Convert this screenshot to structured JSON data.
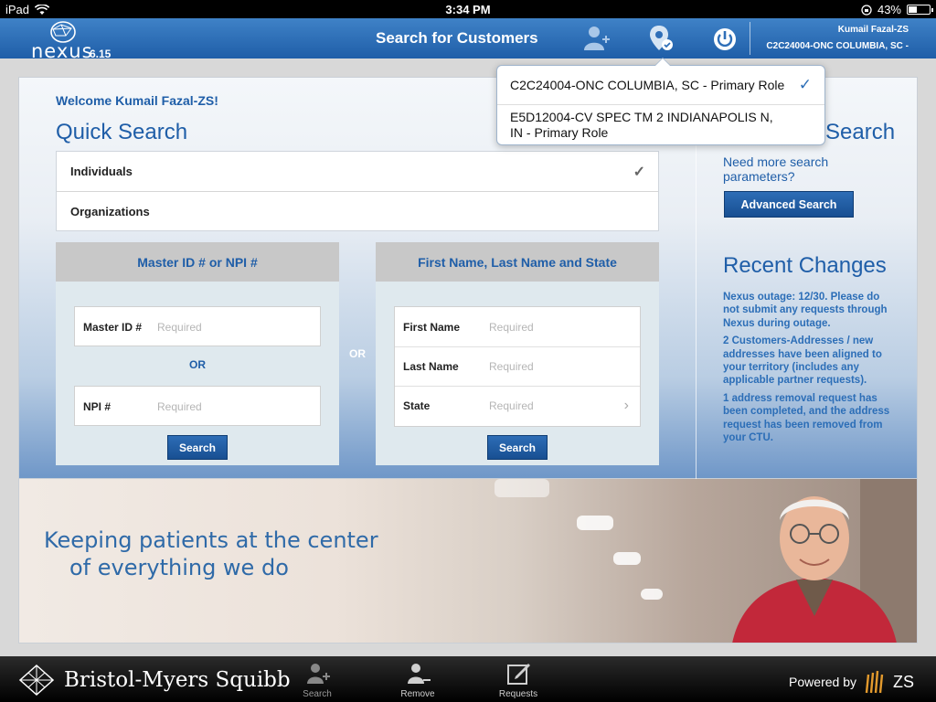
{
  "status_bar": {
    "device": "iPad",
    "time": "3:34 PM",
    "battery": "43%",
    "battery_level": 0.43
  },
  "header": {
    "app_name": "nexus",
    "version": "6.15",
    "title": "Search for Customers",
    "user_name": "Kumail Fazal-ZS",
    "territory": "C2C24004-ONC COLUMBIA, SC -"
  },
  "main": {
    "welcome": "Welcome Kumail Fazal-ZS!",
    "quick_search_title": "Quick Search",
    "segments": [
      {
        "label": "Individuals",
        "selected": true
      },
      {
        "label": "Organizations",
        "selected": false
      }
    ],
    "id_card": {
      "title": "Master ID # or NPI #",
      "master_id_label": "Master ID #",
      "master_id_placeholder": "Required",
      "or_label": "OR",
      "npi_label": "NPI #",
      "npi_placeholder": "Required",
      "search_label": "Search"
    },
    "between_or": "OR",
    "name_card": {
      "title": "First Name, Last Name and State",
      "first_name_label": "First Name",
      "first_name_placeholder": "Required",
      "last_name_label": "Last Name",
      "last_name_placeholder": "Required",
      "state_label": "State",
      "state_placeholder": "Required",
      "search_label": "Search"
    },
    "advanced_title": "Search",
    "need_more": "Need more search parameters?",
    "advanced_button": "Advanced Search",
    "recent_changes_title": "Recent Changes",
    "recent_changes": [
      "Nexus outage: 12/30. Please do not submit any requests through Nexus during outage.",
      "2 Customers-Addresses / new addresses have been aligned to your territory (includes any applicable partner requests).",
      "1 address removal request has been completed, and the address request has been removed from your CTU."
    ]
  },
  "banner": {
    "line1": "Keeping patients at the center",
    "line2": "of everything we do"
  },
  "bottom_bar": {
    "brand": "Bristol-Myers Squibb",
    "tabs": [
      "Search",
      "Remove",
      "Requests"
    ],
    "powered_by": "Powered by",
    "zs": "ZS"
  },
  "role_popover": {
    "items": [
      {
        "label": "C2C24004-ONC COLUMBIA, SC - Primary Role",
        "selected": true
      },
      {
        "label": "E5D12004-CV SPEC TM 2 INDIANAPOLIS N, IN - Primary Role",
        "selected": false
      }
    ]
  },
  "colors": {
    "brand_blue": "#1f5ea8",
    "header_blue": "#2f6fb8",
    "button_blue": "#184f92"
  }
}
